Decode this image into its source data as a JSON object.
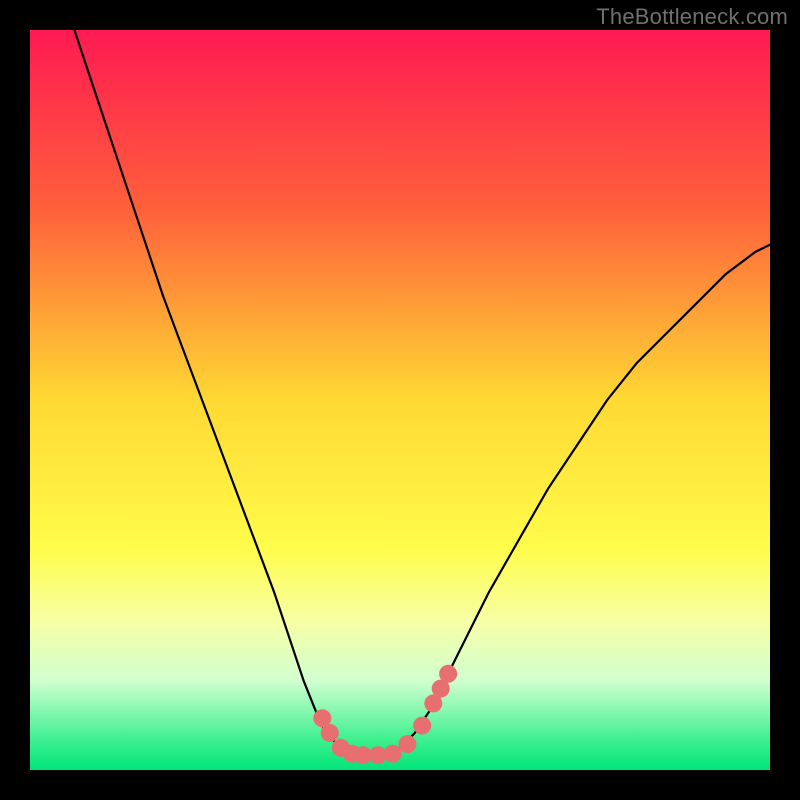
{
  "watermark": "TheBottleneck.com",
  "chart_data": {
    "type": "line",
    "title": "",
    "xlabel": "",
    "ylabel": "",
    "xlim": [
      0,
      100
    ],
    "ylim": [
      0,
      100
    ],
    "gradient_stops": [
      {
        "offset": 0,
        "color": "#ff1a52"
      },
      {
        "offset": 24,
        "color": "#ff5f3b"
      },
      {
        "offset": 50,
        "color": "#ffd933"
      },
      {
        "offset": 70,
        "color": "#fffc4a"
      },
      {
        "offset": 80,
        "color": "#f7ffa6"
      },
      {
        "offset": 88,
        "color": "#d0ffd0"
      },
      {
        "offset": 96,
        "color": "#3cf08e"
      },
      {
        "offset": 100,
        "color": "#00e47a"
      }
    ],
    "series": [
      {
        "name": "bottleneck-curve",
        "color": "#000000",
        "points": [
          {
            "x": 6,
            "y": 100
          },
          {
            "x": 9,
            "y": 91
          },
          {
            "x": 12,
            "y": 82
          },
          {
            "x": 15,
            "y": 73
          },
          {
            "x": 18,
            "y": 64
          },
          {
            "x": 21,
            "y": 56
          },
          {
            "x": 24,
            "y": 48
          },
          {
            "x": 27,
            "y": 40
          },
          {
            "x": 30,
            "y": 32
          },
          {
            "x": 33,
            "y": 24
          },
          {
            "x": 35,
            "y": 18
          },
          {
            "x": 37,
            "y": 12
          },
          {
            "x": 39,
            "y": 7
          },
          {
            "x": 40,
            "y": 5
          },
          {
            "x": 42,
            "y": 3
          },
          {
            "x": 44,
            "y": 2
          },
          {
            "x": 46,
            "y": 2
          },
          {
            "x": 48,
            "y": 2
          },
          {
            "x": 50,
            "y": 3
          },
          {
            "x": 52,
            "y": 5
          },
          {
            "x": 54,
            "y": 8
          },
          {
            "x": 56,
            "y": 12
          },
          {
            "x": 58,
            "y": 16
          },
          {
            "x": 62,
            "y": 24
          },
          {
            "x": 66,
            "y": 31
          },
          {
            "x": 70,
            "y": 38
          },
          {
            "x": 74,
            "y": 44
          },
          {
            "x": 78,
            "y": 50
          },
          {
            "x": 82,
            "y": 55
          },
          {
            "x": 86,
            "y": 59
          },
          {
            "x": 90,
            "y": 63
          },
          {
            "x": 94,
            "y": 67
          },
          {
            "x": 98,
            "y": 70
          },
          {
            "x": 100,
            "y": 71
          }
        ]
      }
    ],
    "markers": {
      "color": "#e76f6f",
      "radius": 9,
      "points": [
        {
          "x": 39.5,
          "y": 7
        },
        {
          "x": 40.5,
          "y": 5
        },
        {
          "x": 42,
          "y": 3
        },
        {
          "x": 43.5,
          "y": 2.2
        },
        {
          "x": 45,
          "y": 2
        },
        {
          "x": 47,
          "y": 2
        },
        {
          "x": 49,
          "y": 2.2
        },
        {
          "x": 51,
          "y": 3.5
        },
        {
          "x": 53,
          "y": 6
        },
        {
          "x": 54.5,
          "y": 9
        },
        {
          "x": 55.5,
          "y": 11
        },
        {
          "x": 56.5,
          "y": 13
        }
      ]
    }
  }
}
